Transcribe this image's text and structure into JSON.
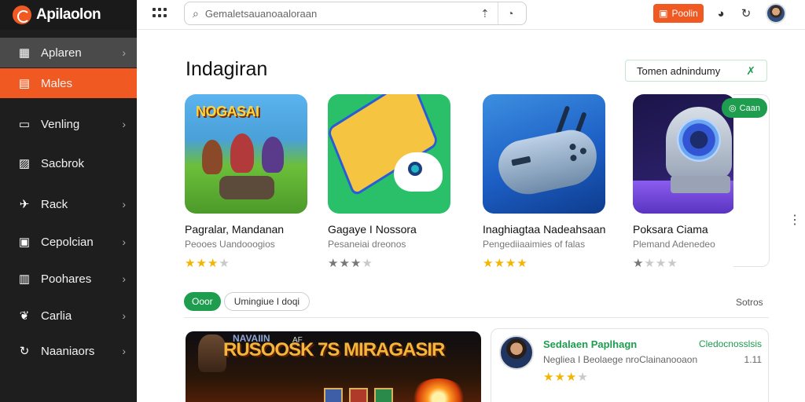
{
  "brand": {
    "name": "Apilaolon"
  },
  "sidebar": {
    "items": [
      {
        "label": "Aplaren",
        "icon": "grid-icon"
      },
      {
        "label": "Males",
        "icon": "table-icon"
      },
      {
        "label": "Venling",
        "icon": "device-icon"
      },
      {
        "label": "Sacbrok",
        "icon": "image-icon"
      },
      {
        "label": "Rack",
        "icon": "pin-icon"
      },
      {
        "label": "Cepolcian",
        "icon": "window-icon"
      },
      {
        "label": "Poohares",
        "icon": "chart-icon"
      },
      {
        "label": "Carlia",
        "icon": "leaf-icon"
      },
      {
        "label": "Naaniaors",
        "icon": "refresh-icon"
      }
    ]
  },
  "topbar": {
    "search_placeholder": "Gemaletsauanoaaloraan",
    "action_label": "Poolin",
    "colors": {
      "accent": "#f05a22",
      "green": "#1e9d4f"
    }
  },
  "main": {
    "title": "Indagiran",
    "filter_label": "Tomen adnindumy",
    "green_pill": "Caan",
    "apps": [
      {
        "title": "Pagralar, Mandanan",
        "subtitle": "Peooes Uandooogios",
        "rating": 3,
        "star_style": "gold",
        "banner": "NOGASAI"
      },
      {
        "title": "Gagaye I Nossora",
        "subtitle": "Pesaneiai dreonos",
        "rating": 3,
        "star_style": "gray"
      },
      {
        "title": "Inaghiagtaa Nadeahsaan",
        "subtitle": "Pengediiaaimies of falas",
        "rating": 4,
        "star_style": "gold"
      },
      {
        "title": "Poksara Ciama",
        "subtitle": "Plemand Adenedeo",
        "rating": 1,
        "star_style": "gray"
      }
    ],
    "tabs": {
      "active": "Ooor",
      "other": "Umingiue I doqi"
    },
    "see_all": "Sotros",
    "featured": {
      "title_top": "NAVAIIN",
      "title": "RUSOOSK 7S MIRAGASIR",
      "tag": "AF"
    },
    "review": {
      "name": "Sedalaen Paplhagn",
      "tag": "Cledocnosslsis",
      "text": "Negliea I Beolaege nroClainanooaon",
      "number": "1.11",
      "rating": 3
    }
  }
}
